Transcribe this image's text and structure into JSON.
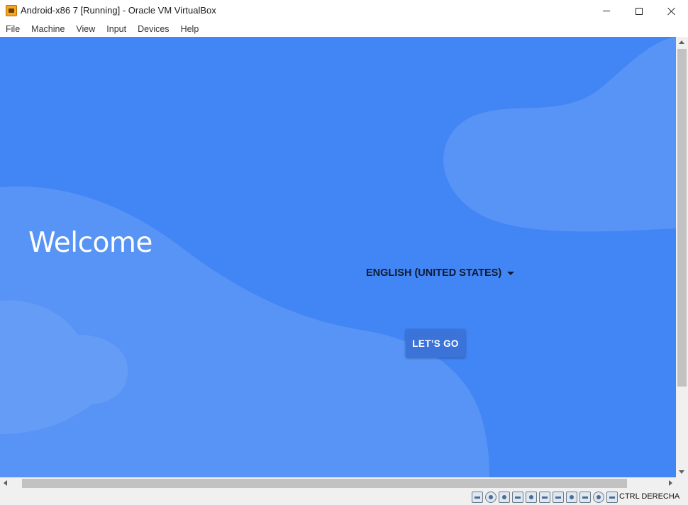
{
  "window": {
    "title": "Android-x86 7 [Running] - Oracle VM VirtualBox",
    "app_icon": "virtualbox-icon"
  },
  "menu": {
    "items": [
      "File",
      "Machine",
      "View",
      "Input",
      "Devices",
      "Help"
    ]
  },
  "android": {
    "welcome_text": "Welcome",
    "language": "ENGLISH (UNITED STATES)",
    "start_button": "LET’S GO"
  },
  "statusbar": {
    "icons": [
      "hard-disk-icon",
      "optical-drive-icon",
      "audio-icon",
      "network-icon",
      "usb-icon",
      "shared-folders-icon",
      "display-icon",
      "video-capture-icon",
      "cpu-icon",
      "mouse-integration-icon",
      "keyboard-capture-icon"
    ],
    "host_key": "CTRL DERECHA"
  },
  "colors": {
    "android_background": "#4285f4",
    "android_wave_light": "#5b96f6",
    "button_background": "#3b73d9",
    "language_text": "#0d1b33"
  }
}
